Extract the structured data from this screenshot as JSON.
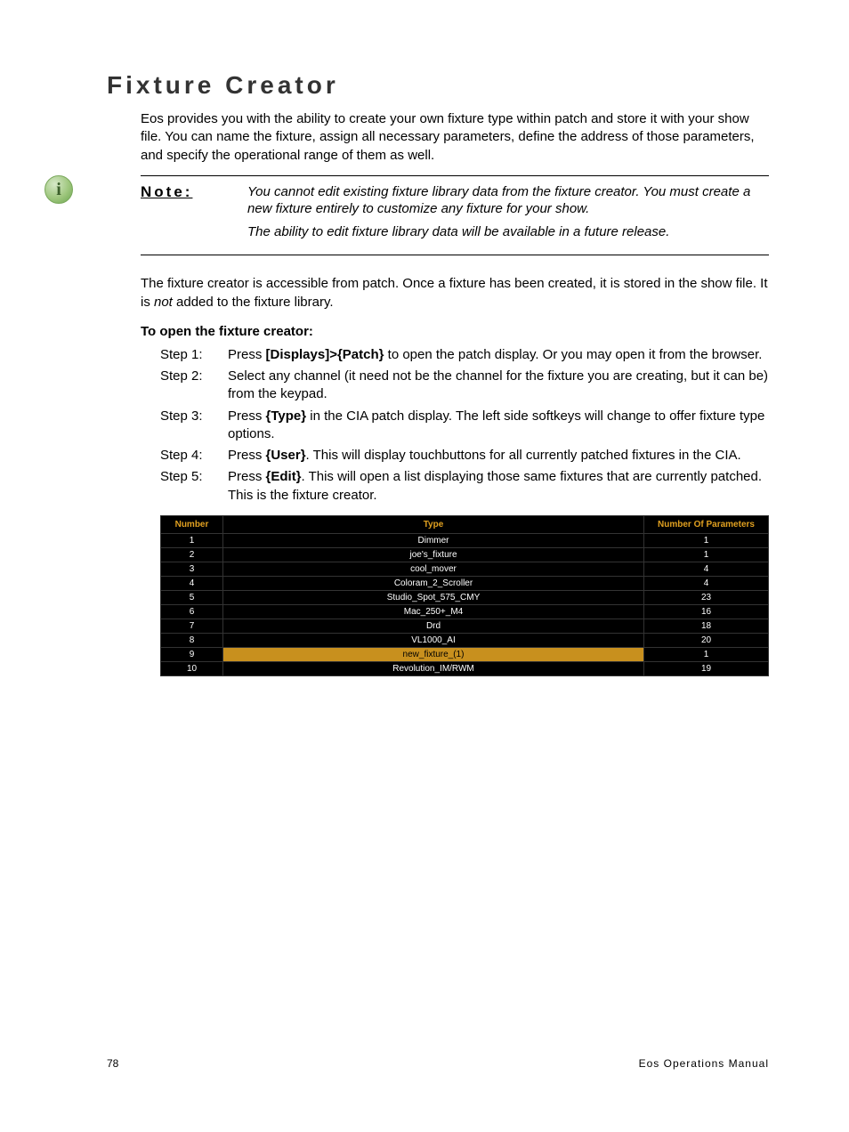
{
  "title": "Fixture Creator",
  "intro": "Eos provides you with the ability to create your own fixture type within patch and store it with your show file. You can name the fixture, assign all necessary parameters, define the address of those parameters, and specify the operational range of them as well.",
  "note": {
    "label": "Note:",
    "p1": "You cannot edit existing fixture library data from the fixture creator. You must create a new fixture entirely to customize any fixture for your show.",
    "p2": "The ability to edit fixture library data will be available in a future release."
  },
  "body": {
    "pre": "The fixture creator is accessible from patch. Once a fixture has been created, it is stored in the show file. It is ",
    "em": "not",
    "post": " added to the fixture library."
  },
  "subhead": "To open the fixture creator:",
  "steps": [
    {
      "label": "Step 1:",
      "pre": "Press ",
      "b": "[Displays]>{Patch}",
      "post": " to open the patch display. Or you may open it from the browser."
    },
    {
      "label": "Step 2:",
      "pre": "Select any channel (it need not be the channel for the fixture you are creating, but it can be) from the keypad.",
      "b": "",
      "post": ""
    },
    {
      "label": "Step 3:",
      "pre": "Press ",
      "b": "{Type}",
      "post": " in the CIA patch display. The left side softkeys will change to offer fixture type options."
    },
    {
      "label": "Step 4:",
      "pre": "Press ",
      "b": "{User}",
      "post": ". This will display touchbuttons for all currently patched fixtures in the CIA."
    },
    {
      "label": "Step 5:",
      "pre": "Press ",
      "b": "{Edit}",
      "post": ". This will open a list displaying those same fixtures that are currently patched. This is the fixture creator."
    }
  ],
  "table": {
    "headers": [
      "Number",
      "Type",
      "Number Of Parameters"
    ],
    "rows": [
      {
        "n": "1",
        "type": "Dimmer",
        "p": "1",
        "selected": false
      },
      {
        "n": "2",
        "type": "joe's_fixture",
        "p": "1",
        "selected": false
      },
      {
        "n": "3",
        "type": "cool_mover",
        "p": "4",
        "selected": false
      },
      {
        "n": "4",
        "type": "Coloram_2_Scroller",
        "p": "4",
        "selected": false
      },
      {
        "n": "5",
        "type": "Studio_Spot_575_CMY",
        "p": "23",
        "selected": false
      },
      {
        "n": "6",
        "type": "Mac_250+_M4",
        "p": "16",
        "selected": false
      },
      {
        "n": "7",
        "type": "Drd",
        "p": "18",
        "selected": false
      },
      {
        "n": "8",
        "type": "VL1000_AI",
        "p": "20",
        "selected": false
      },
      {
        "n": "9",
        "type": "new_fixture_(1)",
        "p": "1",
        "selected": true
      },
      {
        "n": "10",
        "type": "Revolution_IM/RWM",
        "p": "19",
        "selected": false
      }
    ]
  },
  "footer": {
    "page": "78",
    "manual": "Eos Operations Manual"
  }
}
